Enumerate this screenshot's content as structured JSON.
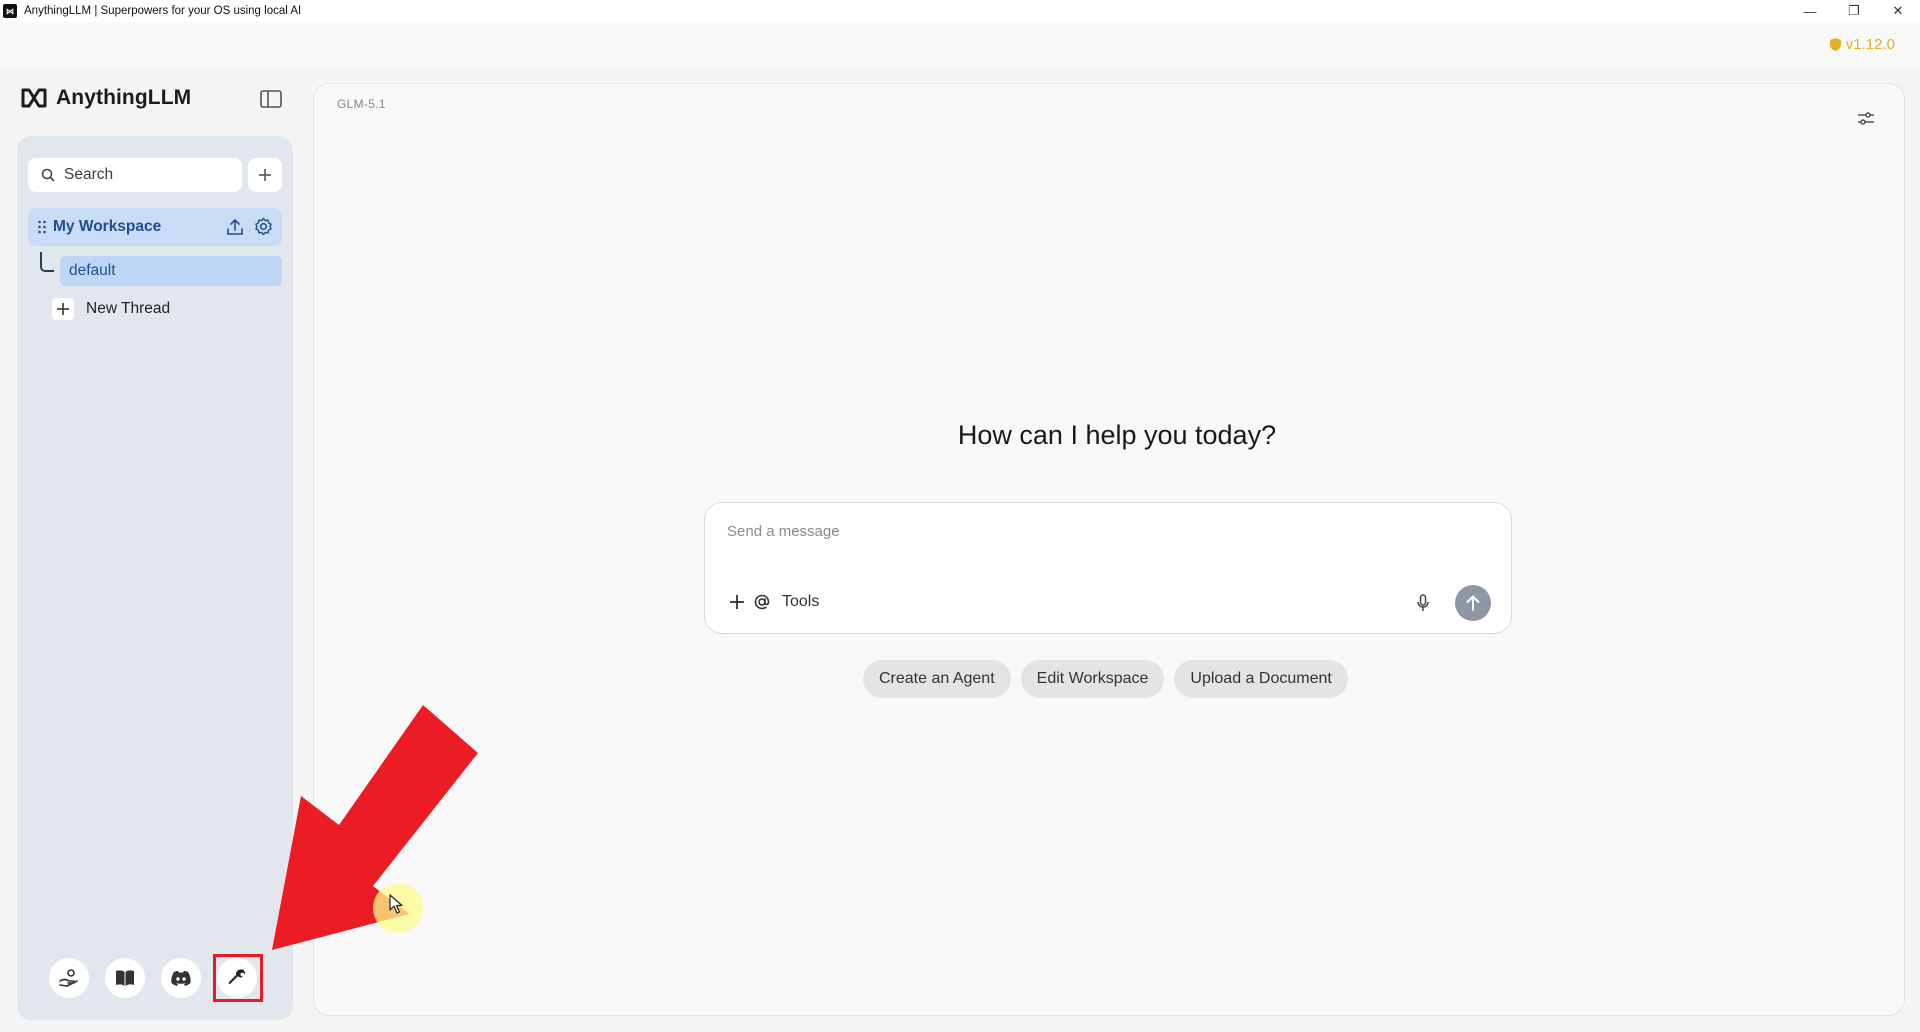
{
  "window": {
    "title": "AnythingLLM | Superpowers for your OS using local AI",
    "logo_text": "⋈",
    "controls": {
      "minimize": "—",
      "restore": "❐",
      "close": "✕"
    }
  },
  "version": {
    "label": "v1.12.0",
    "icon": "shield-icon",
    "color": "#e3b022"
  },
  "brand": {
    "name": "AnythingLLM",
    "logo_icon": "infinity-logo-icon"
  },
  "sidebar": {
    "collapse_icon": "sidebar-toggle-icon",
    "search": {
      "placeholder": "Search",
      "icon": "search-icon"
    },
    "new_workspace_icon": "plus-icon",
    "workspaces": [
      {
        "name": "My Workspace",
        "active": true,
        "actions": [
          "upload-icon",
          "gear-icon"
        ],
        "threads": [
          {
            "name": "default",
            "active": true
          }
        ]
      }
    ],
    "new_thread_label": "New Thread",
    "footer_icons": [
      "community-hub-icon",
      "docs-book-icon",
      "discord-icon",
      "wrench-icon"
    ],
    "accent_active": "#c9dcf6"
  },
  "main": {
    "model_label": "GLM-5.1",
    "settings_icon": "sliders-icon",
    "greeting": "How can I help you today?",
    "composer": {
      "placeholder": "Send a message",
      "tools_label": "Tools",
      "icons": [
        "plus-icon",
        "at-icon",
        "microphone-icon",
        "send-arrow-icon"
      ]
    },
    "suggestions": [
      "Create an Agent",
      "Edit Workspace",
      "Upload a Document"
    ]
  },
  "annotation": {
    "arrow_color": "#e31b23",
    "highlight_target": "wrench-icon"
  }
}
